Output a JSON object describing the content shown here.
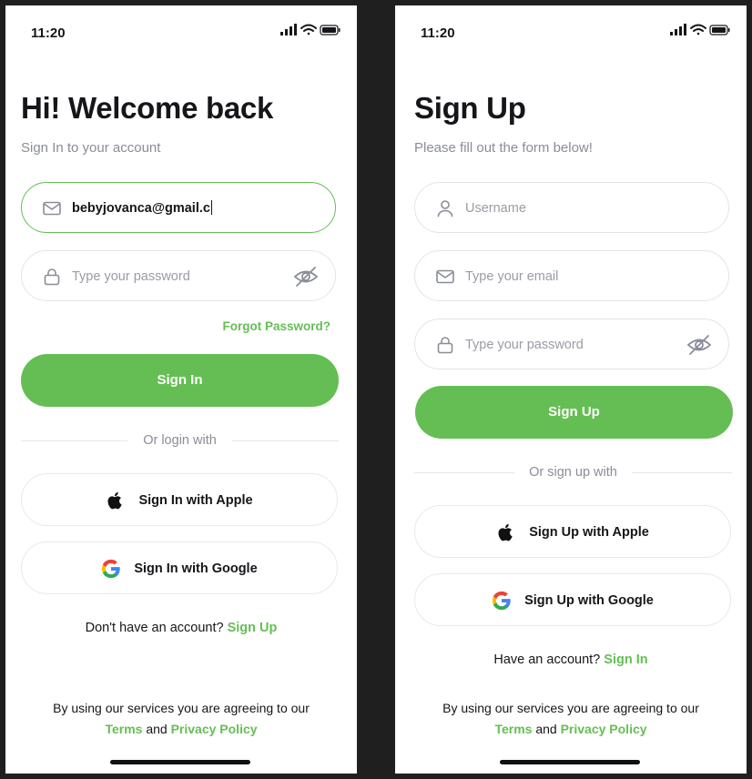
{
  "colors": {
    "accent": "#65be54",
    "text": "#16161a",
    "muted": "#8a8d98",
    "background": "#ffffff"
  },
  "signin": {
    "time": "11:20",
    "title": "Hi! Welcome back",
    "subtitle": "Sign In to your account",
    "email": {
      "value": "bebyjovanca@gmail.c",
      "icon": "mail-icon"
    },
    "password": {
      "placeholder": "Type your password",
      "icon": "lock-icon"
    },
    "forgot": "Forgot Password?",
    "primary": "Sign In",
    "divider": "Or login with",
    "apple": "Sign In with Apple",
    "google": "Sign In with Google",
    "switch_prompt": "Don't have an account?",
    "switch_link": "Sign Up",
    "terms_line1": "By using our services you are agreeing to our",
    "terms_link": "Terms",
    "terms_and": "and",
    "privacy_link": "Privacy Policy"
  },
  "signup": {
    "time": "11:20",
    "title": "Sign Up",
    "subtitle": "Please fill out the form below!",
    "username": {
      "placeholder": "Username",
      "icon": "user-icon"
    },
    "email": {
      "placeholder": "Type your email",
      "icon": "mail-icon"
    },
    "password": {
      "placeholder": "Type your password",
      "icon": "lock-icon"
    },
    "primary": "Sign Up",
    "divider": "Or sign up with",
    "apple": "Sign Up with Apple",
    "google": "Sign Up with Google",
    "switch_prompt": "Have an account?",
    "switch_link": "Sign In",
    "terms_line1": "By using our services you are agreeing to our",
    "terms_link": "Terms",
    "terms_and": "and",
    "privacy_link": "Privacy Policy"
  }
}
